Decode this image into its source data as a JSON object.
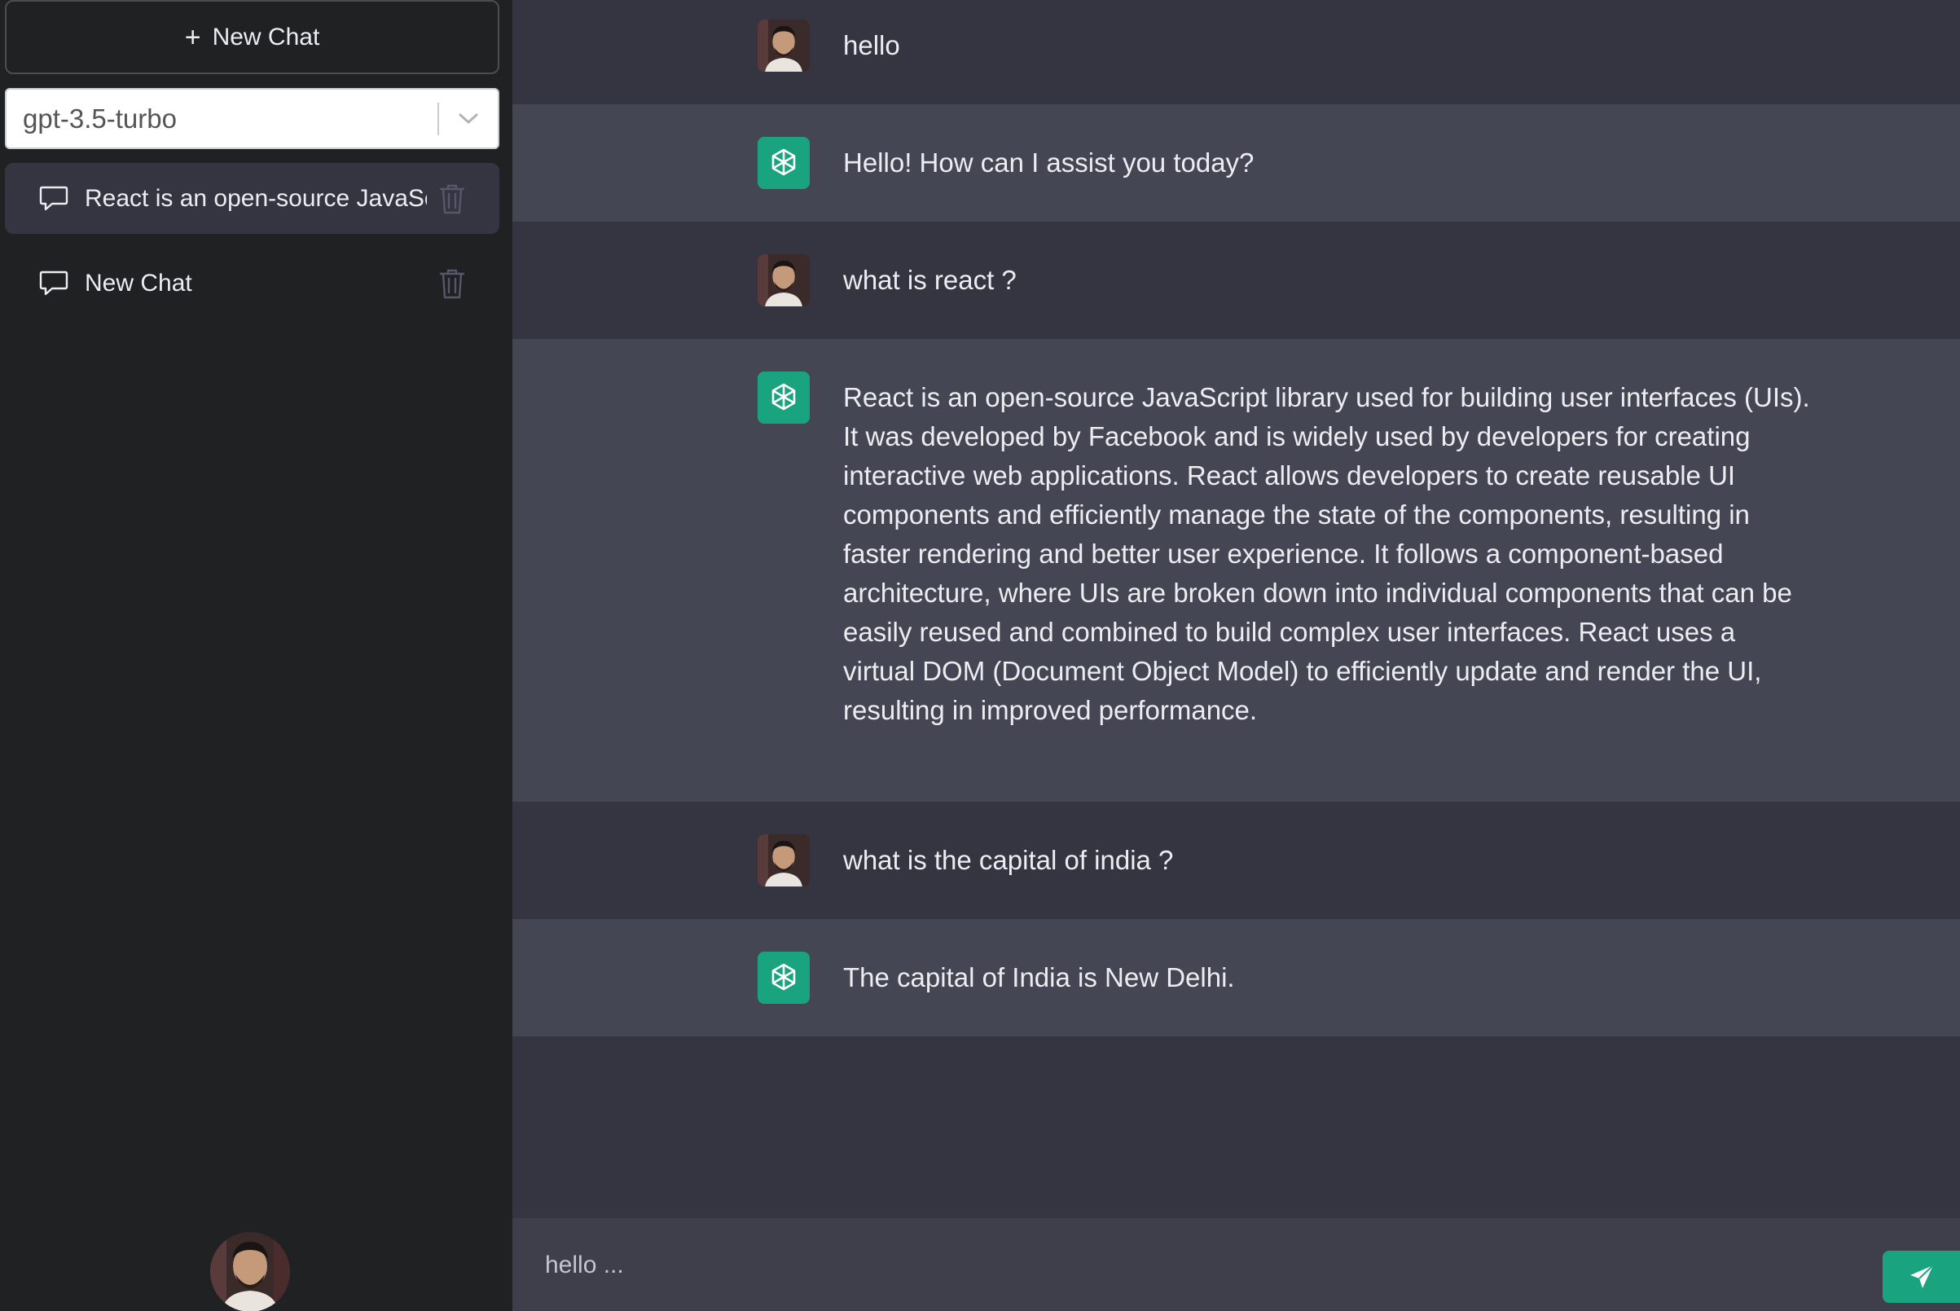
{
  "sidebar": {
    "new_chat_label": "New Chat",
    "model_select": {
      "selected": "gpt-3.5-turbo"
    },
    "chats": [
      {
        "title": "React is an open-source JavaScript library used for building user interfaces",
        "active": true
      },
      {
        "title": "New Chat",
        "active": false
      }
    ]
  },
  "messages": [
    {
      "role": "user",
      "text": "hello"
    },
    {
      "role": "assistant",
      "text": "Hello! How can I assist you today?"
    },
    {
      "role": "user",
      "text": "what is react ?"
    },
    {
      "role": "assistant",
      "text": "React is an open-source JavaScript library used for building user interfaces (UIs). It was developed by Facebook and is widely used by developers for creating interactive web applications. React allows developers to create reusable UI components and efficiently manage the state of the components, resulting in faster rendering and better user experience. It follows a component-based architecture, where UIs are broken down into individual components that can be easily reused and combined to build complex user interfaces. React uses a virtual DOM (Document Object Model) to efficiently update and render the UI, resulting in improved performance."
    },
    {
      "role": "user",
      "text": "what is the capital of india ?"
    },
    {
      "role": "assistant",
      "text": "The capital of India is New Delhi."
    }
  ],
  "composer": {
    "value": "hello ...",
    "placeholder": ""
  },
  "colors": {
    "sidebar_bg": "#202123",
    "main_bg": "#343541",
    "assistant_bg": "#444654",
    "accent": "#19a37f"
  }
}
